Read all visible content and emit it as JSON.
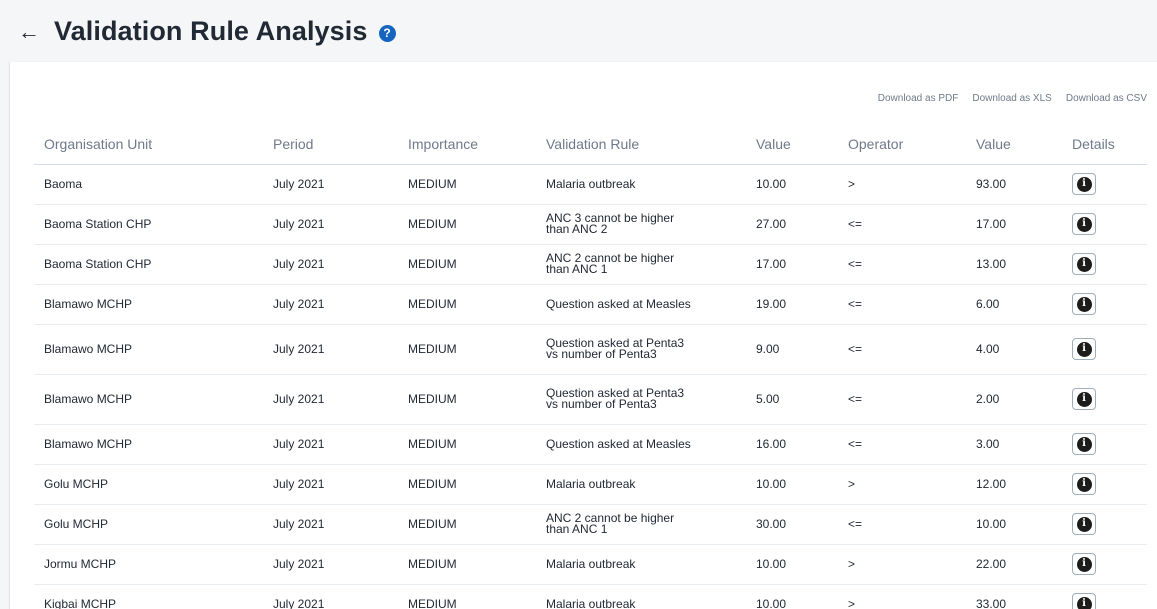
{
  "header": {
    "back_icon": "←",
    "title": "Validation Rule Analysis",
    "help_icon": "?"
  },
  "downloads": {
    "pdf": "Download as PDF",
    "xls": "Download as XLS",
    "csv": "Download as CSV"
  },
  "table": {
    "columns": [
      "Organisation Unit",
      "Period",
      "Importance",
      "Validation Rule",
      "Value",
      "Operator",
      "Value",
      "Details"
    ],
    "info_icon": "i",
    "rows": [
      {
        "org": "Baoma",
        "period": "July 2021",
        "importance": "MEDIUM",
        "rule": "Malaria outbreak",
        "left": "10.00",
        "op": ">",
        "right": "93.00"
      },
      {
        "org": "Baoma Station CHP",
        "period": "July 2021",
        "importance": "MEDIUM",
        "rule": "ANC 3 cannot be higher than ANC 2",
        "left": "27.00",
        "op": "<=",
        "right": "17.00"
      },
      {
        "org": "Baoma Station CHP",
        "period": "July 2021",
        "importance": "MEDIUM",
        "rule": "ANC 2 cannot be higher than ANC 1",
        "left": "17.00",
        "op": "<=",
        "right": "13.00"
      },
      {
        "org": "Blamawo MCHP",
        "period": "July 2021",
        "importance": "MEDIUM",
        "rule": "Question asked at Measles",
        "left": "19.00",
        "op": "<=",
        "right": "6.00"
      },
      {
        "org": "Blamawo MCHP",
        "period": "July 2021",
        "importance": "MEDIUM",
        "rule": "Question asked at Penta3 vs number of Penta3",
        "left": "9.00",
        "op": "<=",
        "right": "4.00"
      },
      {
        "org": "Blamawo MCHP",
        "period": "July 2021",
        "importance": "MEDIUM",
        "rule": "Question asked at Penta3 vs number of Penta3",
        "left": "5.00",
        "op": "<=",
        "right": "2.00"
      },
      {
        "org": "Blamawo MCHP",
        "period": "July 2021",
        "importance": "MEDIUM",
        "rule": "Question asked at Measles",
        "left": "16.00",
        "op": "<=",
        "right": "3.00"
      },
      {
        "org": "Golu MCHP",
        "period": "July 2021",
        "importance": "MEDIUM",
        "rule": "Malaria outbreak",
        "left": "10.00",
        "op": ">",
        "right": "12.00"
      },
      {
        "org": "Golu MCHP",
        "period": "July 2021",
        "importance": "MEDIUM",
        "rule": "ANC 2 cannot be higher than ANC 1",
        "left": "30.00",
        "op": "<=",
        "right": "10.00"
      },
      {
        "org": "Jormu MCHP",
        "period": "July 2021",
        "importance": "MEDIUM",
        "rule": "Malaria outbreak",
        "left": "10.00",
        "op": ">",
        "right": "22.00"
      },
      {
        "org": "Kigbai MCHP",
        "period": "July 2021",
        "importance": "MEDIUM",
        "rule": "Malaria outbreak",
        "left": "10.00",
        "op": ">",
        "right": "33.00"
      }
    ]
  }
}
